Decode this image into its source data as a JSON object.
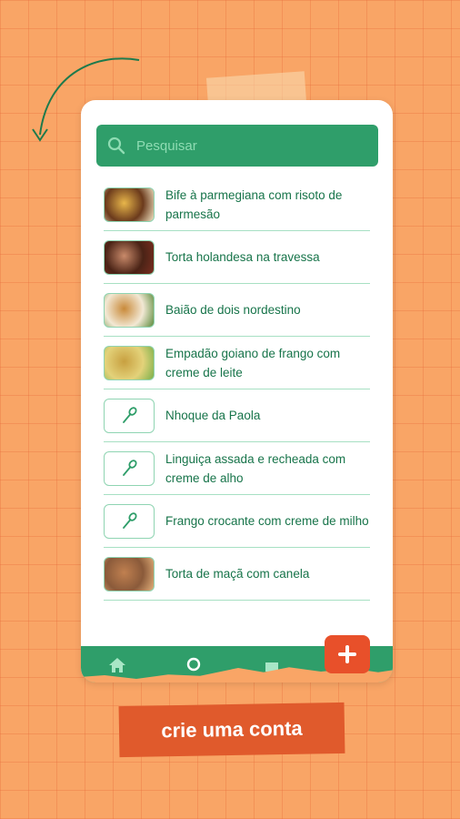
{
  "search": {
    "placeholder": "Pesquisar"
  },
  "recipes": [
    {
      "title": "Bife à parmegiana com risoto de parmesão",
      "thumb": "photo",
      "colors": [
        "#6b3a1c",
        "#e8b64a",
        "#f3e6c5"
      ]
    },
    {
      "title": "Torta holandesa na travessa",
      "thumb": "photo",
      "colors": [
        "#4a2316",
        "#c98a6a",
        "#7a2e20"
      ]
    },
    {
      "title": "Baião de dois nordestino",
      "thumb": "photo",
      "colors": [
        "#f2e8d4",
        "#c98a3a",
        "#5a8a3a"
      ]
    },
    {
      "title": "Empadão goiano de frango com creme de leite",
      "thumb": "photo",
      "colors": [
        "#e3d27a",
        "#c8a040",
        "#7ab04a"
      ]
    },
    {
      "title": "Nhoque da Paola",
      "thumb": "spoon-icon"
    },
    {
      "title": "Linguiça assada e recheada com creme de alho",
      "thumb": "spoon-icon"
    },
    {
      "title": "Frango crocante com creme de milho",
      "thumb": "spoon-icon"
    },
    {
      "title": "Torta de maçã com canela",
      "thumb": "photo",
      "colors": [
        "#8a5a3a",
        "#c08050",
        "#e3b07a"
      ]
    }
  ],
  "nav": {
    "icons": [
      "home-icon",
      "search-icon",
      "cake-icon"
    ]
  },
  "fab": {
    "icon": "plus-icon"
  },
  "cta": {
    "label": "crie uma conta"
  },
  "colors": {
    "green": "#2f9e6a",
    "text_green": "#17744a",
    "orange_bg": "#f9a566",
    "cta_red": "#e05a2c"
  }
}
